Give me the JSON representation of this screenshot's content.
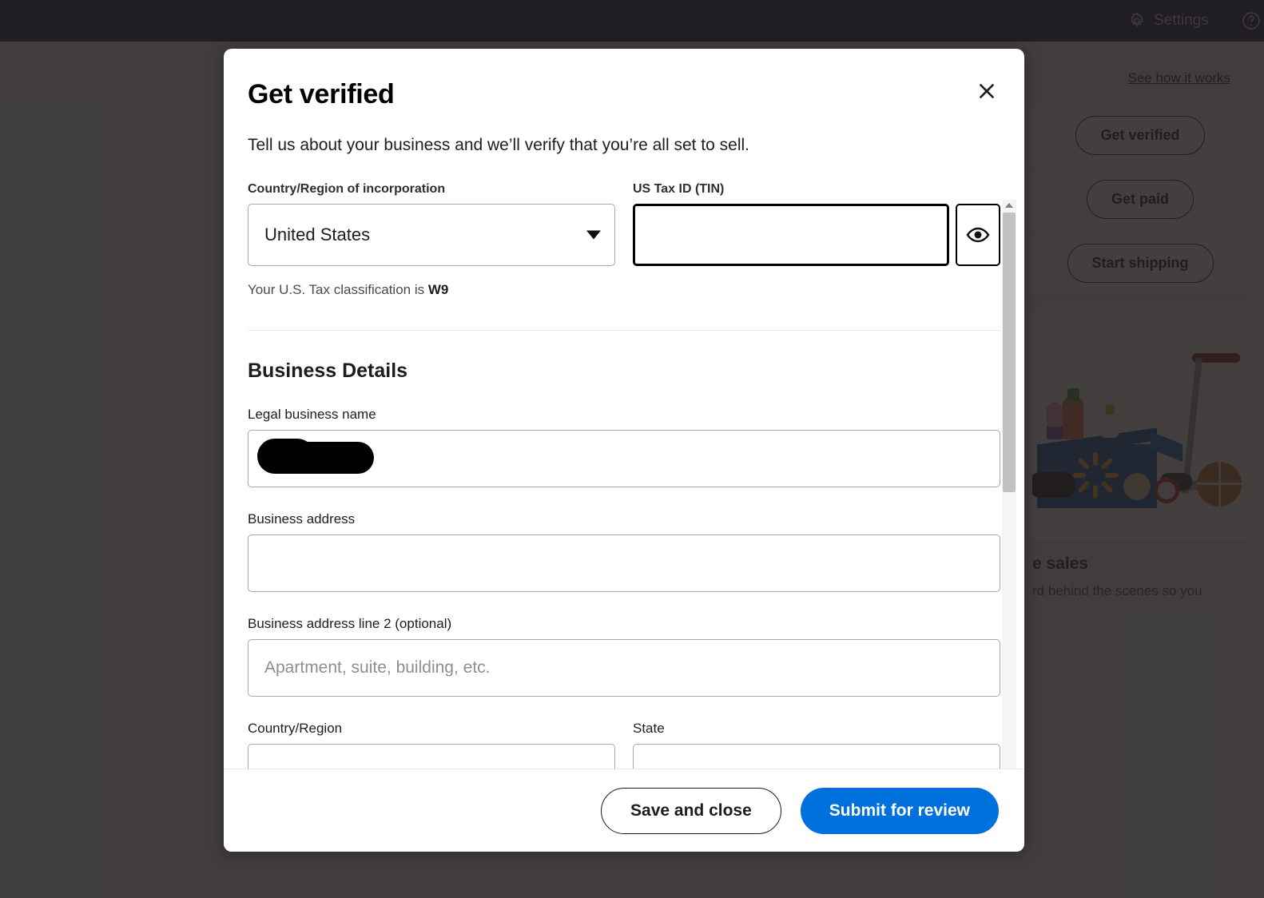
{
  "topbar": {
    "settings_label": "Settings",
    "help_label": "He",
    "background": "#0a1a33"
  },
  "rail": {
    "see_how_label": "See how it works",
    "buttons": [
      {
        "label": "Get verified"
      },
      {
        "label": "Get paid"
      },
      {
        "label": "Start shipping"
      }
    ],
    "caption_title": "e sales",
    "caption_body": "rd behind the scenes so you"
  },
  "modal": {
    "title": "Get verified",
    "close_icon": "close-icon",
    "intro": "Tell us about your business and we’ll verify that you’re all set to sell.",
    "country_incorporation": {
      "label": "Country/Region of incorporation",
      "value": "United States"
    },
    "tax_id": {
      "label": "US Tax ID (TIN)",
      "value": "",
      "placeholder": "",
      "reveal_icon": "eye-icon"
    },
    "tax_classification": {
      "prefix": "Your U.S. Tax classification is",
      "value": "W9"
    },
    "business_details": {
      "section_title": "Business Details",
      "legal_name": {
        "label": "Legal business name",
        "value": "",
        "placeholder": ""
      },
      "address": {
        "label": "Business address",
        "value": "",
        "placeholder": ""
      },
      "address2": {
        "label": "Business address line 2 (optional)",
        "value": "",
        "placeholder": "Apartment, suite, building, etc."
      },
      "country": {
        "label": "Country/Region",
        "value": "",
        "placeholder": ""
      },
      "state": {
        "label": "State",
        "value": "",
        "placeholder": ""
      }
    },
    "footer": {
      "save_label": "Save and close",
      "submit_label": "Submit for review",
      "submit_color": "#0071dc"
    }
  }
}
